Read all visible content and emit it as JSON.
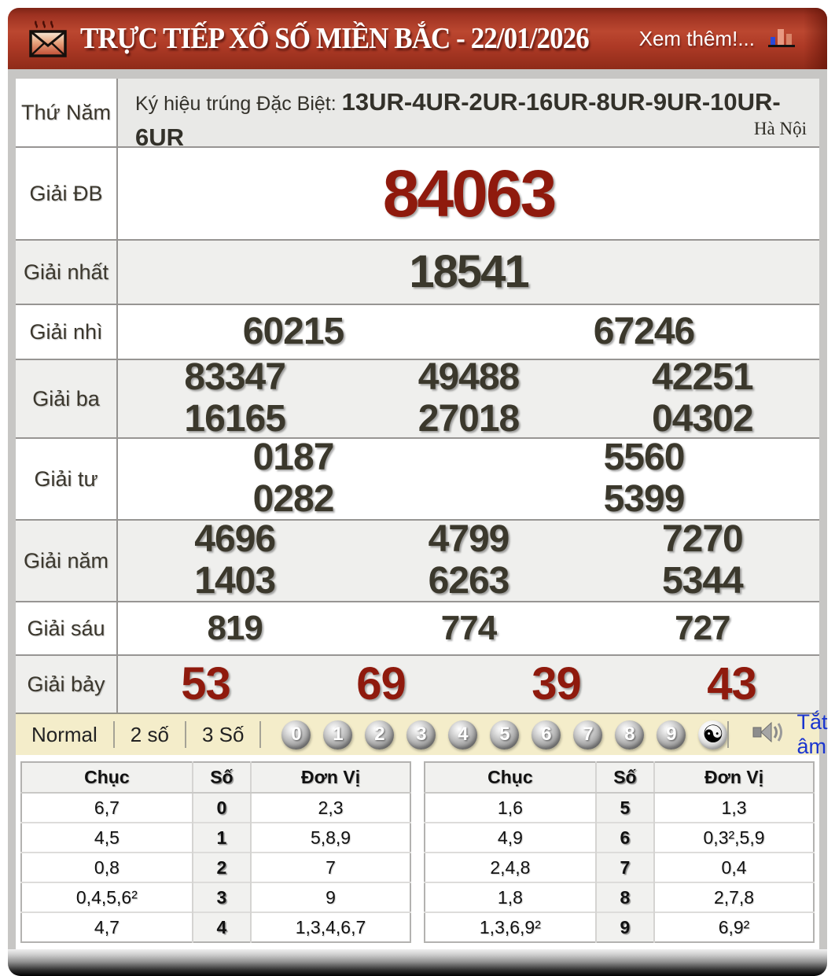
{
  "header": {
    "title": "TRỰC TIẾP XỔ SỐ MIỀN BẮC - 22/01/2026",
    "more_label": "Xem thêm!..."
  },
  "info": {
    "day": "Thứ Năm",
    "symbol_label": "Ký hiệu trúng Đặc Biệt: ",
    "symbol_codes": "13UR-4UR-2UR-16UR-8UR-9UR-10UR-6UR",
    "region": "Hà Nội"
  },
  "prizes": {
    "rows": [
      {
        "label": "Giải ĐB",
        "values": [
          "84063"
        ]
      },
      {
        "label": "Giải nhất",
        "values": [
          "18541"
        ]
      },
      {
        "label": "Giải nhì",
        "values": [
          "60215",
          "67246"
        ]
      },
      {
        "label": "Giải ba",
        "values": [
          "83347",
          "49488",
          "42251",
          "16165",
          "27018",
          "04302"
        ]
      },
      {
        "label": "Giải tư",
        "values": [
          "0187",
          "5560",
          "0282",
          "5399"
        ]
      },
      {
        "label": "Giải năm",
        "values": [
          "4696",
          "4799",
          "7270",
          "1403",
          "6263",
          "5344"
        ]
      },
      {
        "label": "Giải sáu",
        "values": [
          "819",
          "774",
          "727"
        ]
      },
      {
        "label": "Giải bảy",
        "values": [
          "53",
          "69",
          "39",
          "43"
        ]
      }
    ]
  },
  "controls": {
    "modes": [
      "Normal",
      "2 số",
      "3 Số"
    ],
    "balls": [
      "0",
      "1",
      "2",
      "3",
      "4",
      "5",
      "6",
      "7",
      "8",
      "9"
    ],
    "yin_yang": "☯",
    "mute_label": "Tắt âm"
  },
  "digit_tables": {
    "headers": [
      "Chục",
      "Số",
      "Đơn Vị"
    ],
    "left": [
      [
        "6,7",
        "0",
        "2,3"
      ],
      [
        "4,5",
        "1",
        "5,8,9"
      ],
      [
        "0,8",
        "2",
        "7"
      ],
      [
        "0,4,5,6²",
        "3",
        "9"
      ],
      [
        "4,7",
        "4",
        "1,3,4,6,7"
      ]
    ],
    "right": [
      [
        "1,6",
        "5",
        "1,3"
      ],
      [
        "4,9",
        "6",
        "0,3²,5,9"
      ],
      [
        "2,4,8",
        "7",
        "0,4"
      ],
      [
        "1,8",
        "8",
        "2,7,8"
      ],
      [
        "1,3,6,9²",
        "9",
        "6,9²"
      ]
    ]
  },
  "colors": {
    "header_red": "#ae3a26",
    "prize_red": "#8f1a0d",
    "prize_dark": "#3b382c",
    "controls_bg": "#f4edca",
    "mute_blue": "#1a35cf",
    "frame_gray": "#c7c6c4"
  }
}
